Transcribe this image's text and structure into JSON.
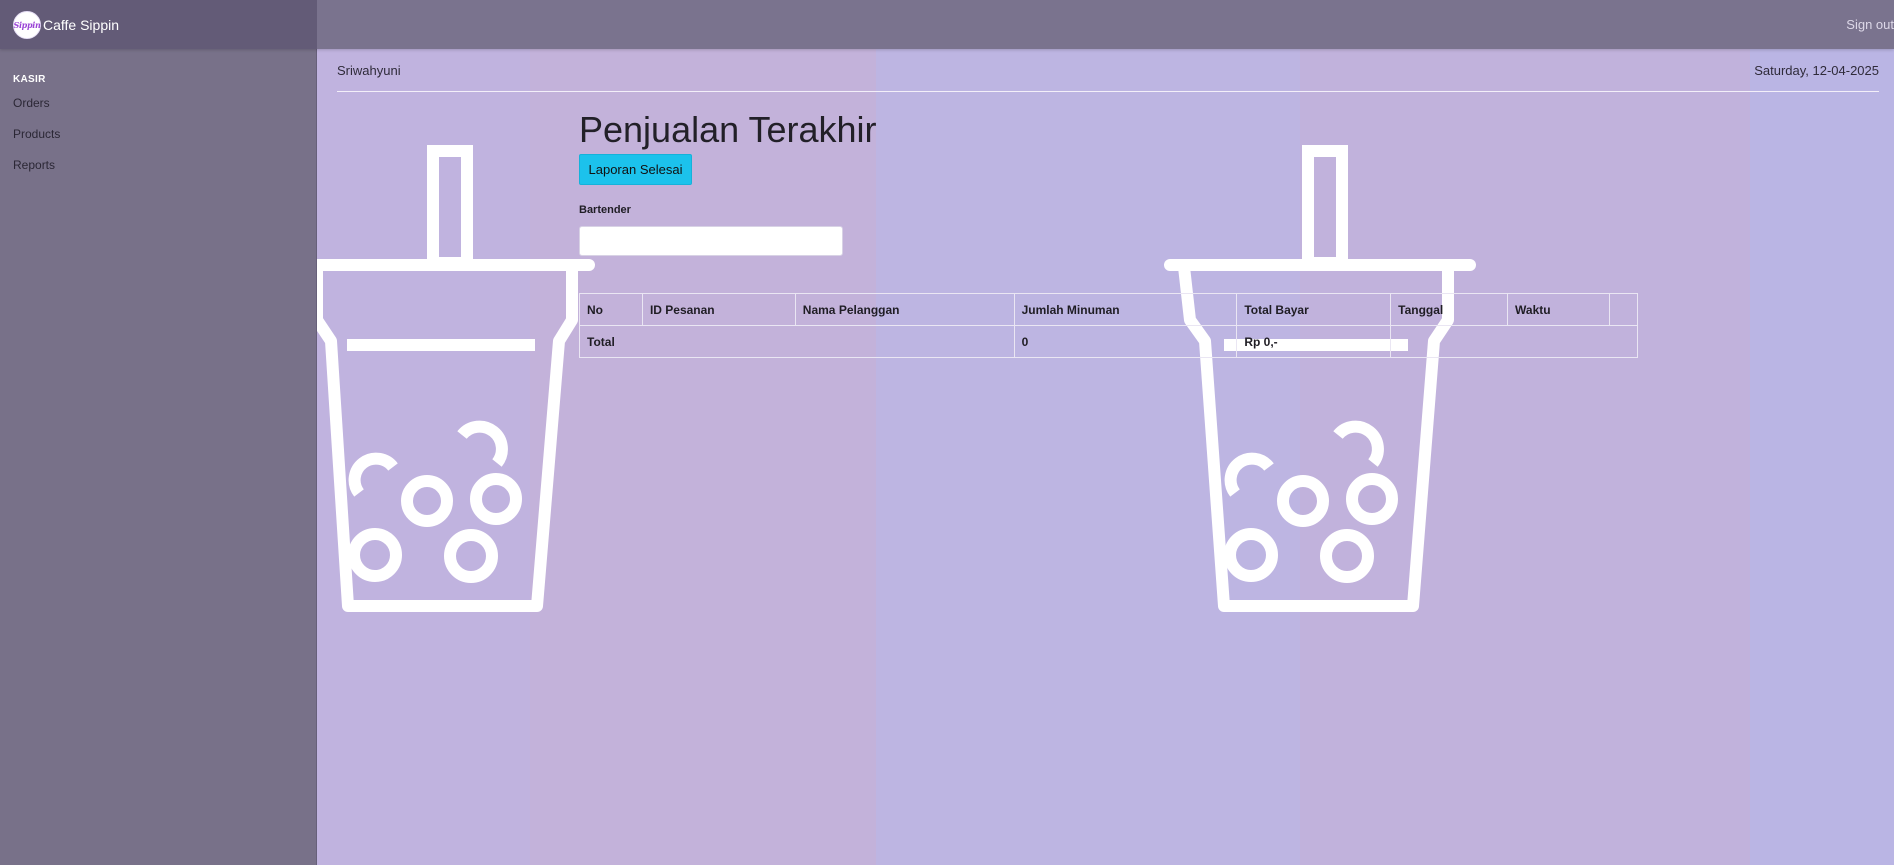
{
  "app": {
    "brand_name": "Caffe Sippin",
    "logo_text": "Sippin",
    "signout_label": "Sign out"
  },
  "sidebar": {
    "heading": "KASIR",
    "items": [
      {
        "label": "Orders"
      },
      {
        "label": "Products"
      },
      {
        "label": "Reports"
      }
    ]
  },
  "header": {
    "user_name": "Sriwahyuni",
    "date": "Saturday, 12-04-2025"
  },
  "main": {
    "title": "Penjualan Terakhir",
    "report_button_label": "Laporan Selesai",
    "bartender_label": "Bartender",
    "bartender_value": "",
    "bartender_placeholder": ""
  },
  "table": {
    "columns": [
      "No",
      "ID Pesanan",
      "Nama Pelanggan",
      "Jumlah Minuman",
      "Total Bayar",
      "Tanggal",
      "Waktu",
      ""
    ],
    "total_row": {
      "label": "Total",
      "jumlah_minuman": "0",
      "total_bayar": "Rp 0,-"
    }
  },
  "colors": {
    "accent_button": "#1cc2ec",
    "topbar": "#7a738e",
    "sidebar": "#787189",
    "background": "#c1b4df"
  },
  "icons": {
    "background_decoration": "bubble-tea-cup-icon",
    "logo": "sippin-logo"
  }
}
